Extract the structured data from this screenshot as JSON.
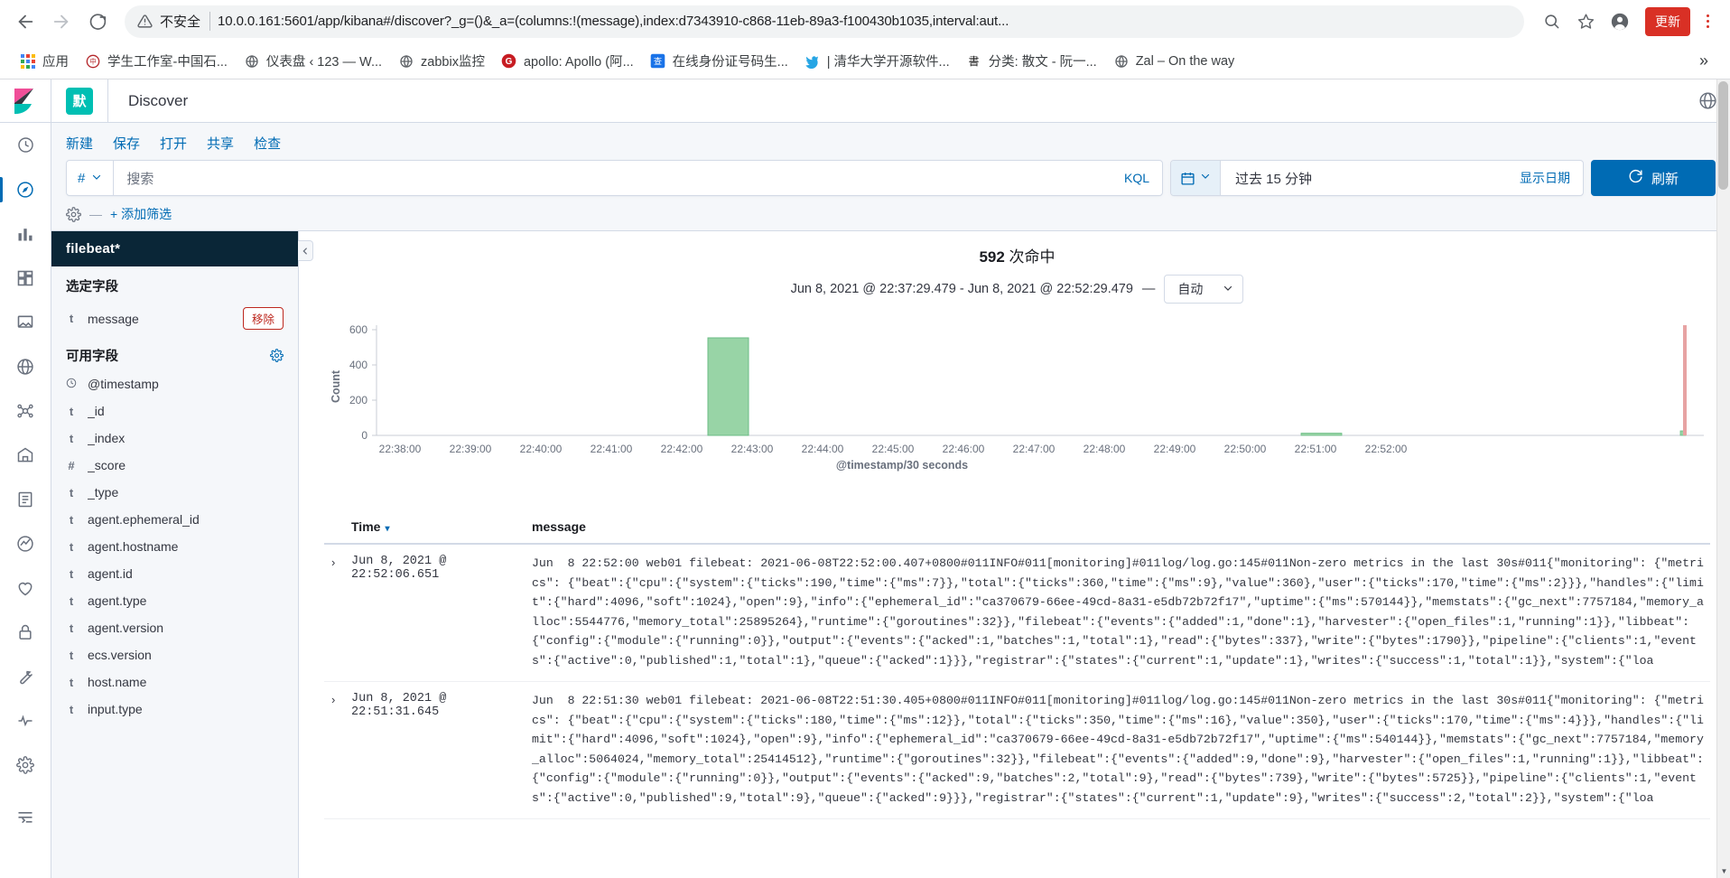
{
  "browser": {
    "security_label": "不安全",
    "url": "10.0.0.161:5601/app/kibana#/discover?_g=()&_a=(columns:!(message),index:d7343910-c868-11eb-89a3-f100430b1035,interval:aut...",
    "update_button": "更新",
    "back_icon": "back-arrow-icon",
    "forward_icon": "forward-arrow-icon",
    "reload_icon": "reload-icon",
    "zoom_icon": "zoom-search-icon",
    "bookmark_star_icon": "star-icon",
    "profile_icon": "profile-avatar-icon",
    "bookmarks": [
      {
        "label": "应用",
        "icon": "apps-grid-icon"
      },
      {
        "label": "学生工作室-中国石...",
        "icon": "seal-icon"
      },
      {
        "label": "仪表盘 ‹ 123 — W...",
        "icon": "globe-icon"
      },
      {
        "label": "zabbix监控",
        "icon": "globe-icon"
      },
      {
        "label": "apollo: Apollo (阿...",
        "icon": "gitee-g-icon"
      },
      {
        "label": "在线身份证号码生...",
        "icon": "cha-icon"
      },
      {
        "label": "| 清华大学开源软件...",
        "icon": "bird-icon"
      },
      {
        "label": "分类: 散文 - 阮一...",
        "icon": "brush-icon"
      },
      {
        "label": "Zal – On the way",
        "icon": "globe-icon"
      }
    ],
    "overflow_label": "»"
  },
  "kibana": {
    "space_badge": "默",
    "app_title": "Discover",
    "left_nav": [
      {
        "name": "recently-viewed",
        "icon": "clock-icon"
      },
      {
        "name": "discover",
        "icon": "compass-icon",
        "selected": true
      },
      {
        "name": "visualize",
        "icon": "bar-chart-icon"
      },
      {
        "name": "dashboard",
        "icon": "dashboard-icon"
      },
      {
        "name": "canvas",
        "icon": "canvas-icon"
      },
      {
        "name": "maps",
        "icon": "globe-pin-icon"
      },
      {
        "name": "machine-learning",
        "icon": "ml-icon"
      },
      {
        "name": "infrastructure",
        "icon": "infra-icon"
      },
      {
        "name": "logs",
        "icon": "logs-icon"
      },
      {
        "name": "apm",
        "icon": "apm-icon"
      },
      {
        "name": "uptime",
        "icon": "uptime-icon"
      },
      {
        "name": "siem",
        "icon": "lock-icon"
      },
      {
        "name": "dev-tools",
        "icon": "wrench-icon"
      },
      {
        "name": "monitoring",
        "icon": "heart-icon"
      },
      {
        "name": "management",
        "icon": "gear-icon"
      },
      {
        "name": "collapse-nav",
        "icon": "collapse-icon"
      }
    ],
    "help_icon": "help-globe-icon",
    "topnav": [
      {
        "label": "新建",
        "name": "new"
      },
      {
        "label": "保存",
        "name": "save"
      },
      {
        "label": "打开",
        "name": "open"
      },
      {
        "label": "共享",
        "name": "share"
      },
      {
        "label": "检查",
        "name": "inspect"
      }
    ],
    "query": {
      "field_type_glyph": "#",
      "placeholder": "搜索",
      "value": "",
      "language": "KQL"
    },
    "date_picker": {
      "calendar_icon": "calendar-icon",
      "range_label": "过去 15 分钟",
      "show_dates": "显示日期"
    },
    "refresh_button": "刷新",
    "filter_bar": {
      "gear_icon": "gear-icon",
      "dash": "—",
      "add_filter": "+ 添加筛选"
    },
    "sidebar": {
      "index_pattern": "filebeat*",
      "selected_fields_title": "选定字段",
      "available_fields_title": "可用字段",
      "selected_fields": [
        {
          "type": "t",
          "name": "message",
          "action": "移除"
        }
      ],
      "available_fields": [
        {
          "type": "clock",
          "name": "@timestamp"
        },
        {
          "type": "t",
          "name": "_id"
        },
        {
          "type": "t",
          "name": "_index"
        },
        {
          "type": "#",
          "name": "_score"
        },
        {
          "type": "t",
          "name": "_type"
        },
        {
          "type": "t",
          "name": "agent.ephemeral_id"
        },
        {
          "type": "t",
          "name": "agent.hostname"
        },
        {
          "type": "t",
          "name": "agent.id"
        },
        {
          "type": "t",
          "name": "agent.type"
        },
        {
          "type": "t",
          "name": "agent.version"
        },
        {
          "type": "t",
          "name": "ecs.version"
        },
        {
          "type": "t",
          "name": "host.name"
        },
        {
          "type": "t",
          "name": "input.type"
        }
      ],
      "collapse_icon": "chevron-left-icon"
    },
    "results": {
      "hits_count": "592",
      "hits_suffix": "次命中",
      "time_range": "Jun 8, 2021 @ 22:37:29.479 - Jun 8, 2021 @ 22:52:29.479",
      "dash": "—",
      "interval_value": "自动"
    },
    "doc_table": {
      "columns": [
        "Time",
        "message"
      ],
      "sort_caret": "▾",
      "expand_glyph": "›",
      "rows": [
        {
          "time": "Jun 8, 2021 @ 22:52:06.651",
          "message": "Jun  8 22:52:00 web01 filebeat: 2021-06-08T22:52:00.407+0800#011INFO#011[monitoring]#011log/log.go:145#011Non-zero metrics in the last 30s#011{\"monitoring\": {\"metrics\": {\"beat\":{\"cpu\":{\"system\":{\"ticks\":190,\"time\":{\"ms\":7}},\"total\":{\"ticks\":360,\"time\":{\"ms\":9},\"value\":360},\"user\":{\"ticks\":170,\"time\":{\"ms\":2}}},\"handles\":{\"limit\":{\"hard\":4096,\"soft\":1024},\"open\":9},\"info\":{\"ephemeral_id\":\"ca370679-66ee-49cd-8a31-e5db72b72f17\",\"uptime\":{\"ms\":570144}},\"memstats\":{\"gc_next\":7757184,\"memory_alloc\":5544776,\"memory_total\":25895264},\"runtime\":{\"goroutines\":32}},\"filebeat\":{\"events\":{\"added\":1,\"done\":1},\"harvester\":{\"open_files\":1,\"running\":1}},\"libbeat\":{\"config\":{\"module\":{\"running\":0}},\"output\":{\"events\":{\"acked\":1,\"batches\":1,\"total\":1},\"read\":{\"bytes\":337},\"write\":{\"bytes\":1790}},\"pipeline\":{\"clients\":1,\"events\":{\"active\":0,\"published\":1,\"total\":1},\"queue\":{\"acked\":1}}},\"registrar\":{\"states\":{\"current\":1,\"update\":1},\"writes\":{\"success\":1,\"total\":1}},\"system\":{\"loa"
        },
        {
          "time": "Jun 8, 2021 @ 22:51:31.645",
          "message": "Jun  8 22:51:30 web01 filebeat: 2021-06-08T22:51:30.405+0800#011INFO#011[monitoring]#011log/log.go:145#011Non-zero metrics in the last 30s#011{\"monitoring\": {\"metrics\": {\"beat\":{\"cpu\":{\"system\":{\"ticks\":180,\"time\":{\"ms\":12}},\"total\":{\"ticks\":350,\"time\":{\"ms\":16},\"value\":350},\"user\":{\"ticks\":170,\"time\":{\"ms\":4}}},\"handles\":{\"limit\":{\"hard\":4096,\"soft\":1024},\"open\":9},\"info\":{\"ephemeral_id\":\"ca370679-66ee-49cd-8a31-e5db72b72f17\",\"uptime\":{\"ms\":540144}},\"memstats\":{\"gc_next\":7757184,\"memory_alloc\":5064024,\"memory_total\":25414512},\"runtime\":{\"goroutines\":32}},\"filebeat\":{\"events\":{\"added\":9,\"done\":9},\"harvester\":{\"open_files\":1,\"running\":1}},\"libbeat\":{\"config\":{\"module\":{\"running\":0}},\"output\":{\"events\":{\"acked\":9,\"batches\":2,\"total\":9},\"read\":{\"bytes\":739},\"write\":{\"bytes\":5725}},\"pipeline\":{\"clients\":1,\"events\":{\"active\":0,\"published\":9,\"total\":9},\"queue\":{\"acked\":9}}},\"registrar\":{\"states\":{\"current\":1,\"update\":9},\"writes\":{\"success\":2,\"total\":2}},\"system\":{\"loa"
        }
      ]
    }
  },
  "chart_data": {
    "type": "bar",
    "title": "",
    "xlabel": "@timestamp/30 seconds",
    "ylabel": "Count",
    "ylim": [
      0,
      600
    ],
    "yticks": [
      0,
      200,
      400,
      600
    ],
    "xticks": [
      "22:38:00",
      "22:39:00",
      "22:40:00",
      "22:41:00",
      "22:42:00",
      "22:43:00",
      "22:44:00",
      "22:45:00",
      "22:46:00",
      "22:47:00",
      "22:48:00",
      "22:49:00",
      "22:50:00",
      "22:51:00",
      "22:52:00"
    ],
    "grid": false,
    "legend": "none",
    "bar_color": "#98d4a6",
    "bar_border_color": "#6bbd85",
    "marker_color": "#e7a3a3",
    "categories": [
      "22:37:30",
      "22:38:00",
      "22:38:30",
      "22:39:00",
      "22:39:30",
      "22:40:00",
      "22:40:30",
      "22:41:00",
      "22:41:30",
      "22:42:00",
      "22:42:30",
      "22:43:00",
      "22:43:30",
      "22:44:00",
      "22:44:30",
      "22:45:00",
      "22:45:30",
      "22:46:00",
      "22:46:30",
      "22:47:00",
      "22:47:30",
      "22:48:00",
      "22:48:30",
      "22:49:00",
      "22:49:30",
      "22:50:00",
      "22:50:30",
      "22:51:00",
      "22:51:30",
      "22:52:00"
    ],
    "values": [
      0,
      0,
      0,
      0,
      0,
      0,
      0,
      0,
      0,
      0,
      560,
      0,
      0,
      0,
      0,
      0,
      0,
      0,
      0,
      0,
      0,
      0,
      0,
      0,
      0,
      0,
      0,
      0,
      9,
      22
    ]
  }
}
